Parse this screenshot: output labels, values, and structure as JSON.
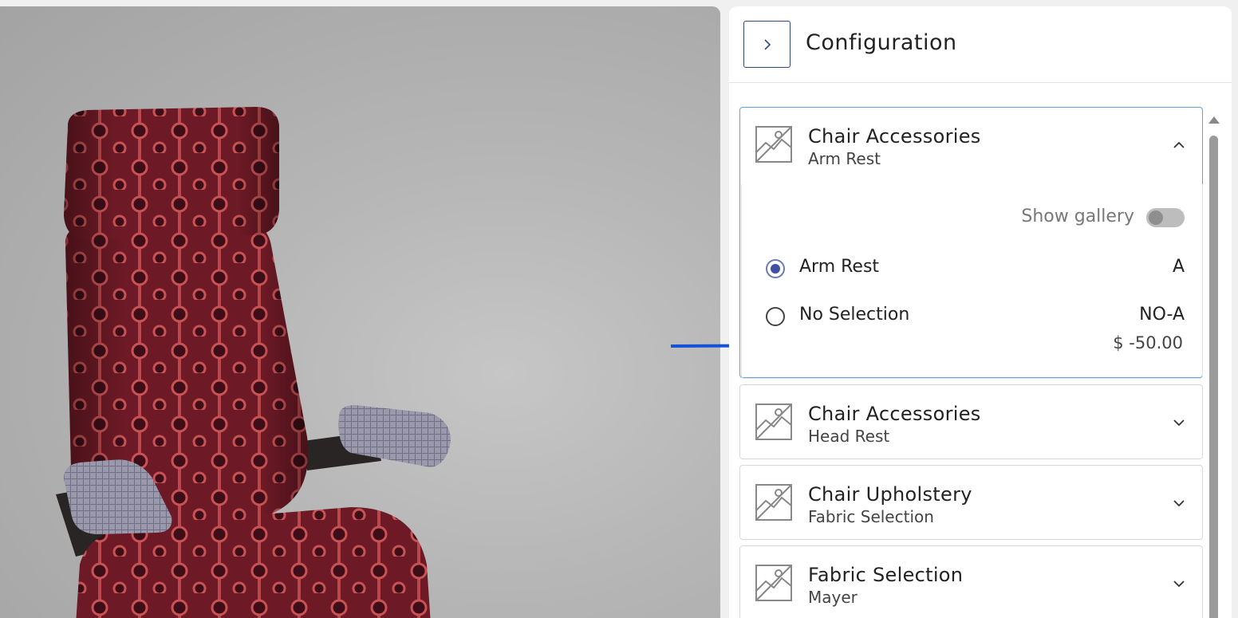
{
  "panel": {
    "title": "Configuration",
    "collapse_icon": "chevron-right-icon"
  },
  "sections": [
    {
      "title": "Chair Accessories",
      "subtitle": "Arm Rest",
      "expanded": true,
      "show_gallery_label": "Show gallery",
      "show_gallery_on": false,
      "options": [
        {
          "label": "Arm Rest",
          "code": "A",
          "selected": true
        },
        {
          "label": "No Selection",
          "code": "NO-A",
          "selected": false,
          "price": "$ -50.00"
        }
      ]
    },
    {
      "title": "Chair Accessories",
      "subtitle": "Head Rest",
      "expanded": false
    },
    {
      "title": "Chair Upholstery",
      "subtitle": "Fabric Selection",
      "expanded": false
    },
    {
      "title": "Fabric Selection",
      "subtitle": "Mayer",
      "expanded": false
    }
  ],
  "colors": {
    "accent": "#3f51a3",
    "annotation_arrow": "#1652d6",
    "open_border": "#5aa7d8"
  }
}
